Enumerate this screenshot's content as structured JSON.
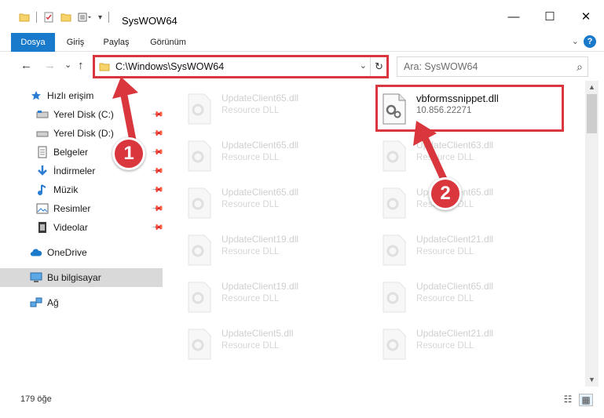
{
  "window": {
    "title": "SysWOW64",
    "minimize": "—",
    "maximize": "☐",
    "close": "✕"
  },
  "ribbon": {
    "tabs": [
      "Dosya",
      "Giriş",
      "Paylaş",
      "Görünüm"
    ],
    "help": "?"
  },
  "navigation": {
    "back": "←",
    "forward": "→",
    "recent": "⌄",
    "up": "↑",
    "address": "C:\\Windows\\SysWOW64",
    "refresh": "↻",
    "search_placeholder": "Ara: SysWOW64"
  },
  "sidebar": {
    "items": [
      {
        "label": "Hızlı erişim",
        "icon": "star-icon",
        "pinned": false
      },
      {
        "label": "Yerel Disk (C:)",
        "icon": "drive-icon",
        "pinned": true
      },
      {
        "label": "Yerel Disk (D:)",
        "icon": "drive-icon",
        "pinned": true
      },
      {
        "label": "Belgeler",
        "icon": "documents-icon",
        "pinned": true
      },
      {
        "label": "İndirmeler",
        "icon": "download-icon",
        "pinned": true
      },
      {
        "label": "Müzik",
        "icon": "music-icon",
        "pinned": true
      },
      {
        "label": "Resimler",
        "icon": "pictures-icon",
        "pinned": true
      },
      {
        "label": "Videolar",
        "icon": "videos-icon",
        "pinned": true
      },
      {
        "label": "OneDrive",
        "icon": "cloud-icon",
        "pinned": false
      },
      {
        "label": "Bu bilgisayar",
        "icon": "computer-icon",
        "pinned": false,
        "selected": true
      },
      {
        "label": "Ağ",
        "icon": "network-icon",
        "pinned": false
      }
    ]
  },
  "files": {
    "highlighted": {
      "name": "vbformssnippet.dll",
      "subtitle": "10.856.22271"
    },
    "left_column": [
      {
        "name": "UpdateClient65.dll",
        "subtitle": "Resource DLL"
      },
      {
        "name": "UpdateClient65.dll",
        "subtitle": "Resource DLL"
      },
      {
        "name": "UpdateClient65.dll",
        "subtitle": "Resource DLL"
      },
      {
        "name": "UpdateClient19.dll",
        "subtitle": "Resource DLL"
      },
      {
        "name": "UpdateClient19.dll",
        "subtitle": "Resource DLL"
      },
      {
        "name": "UpdateClient5.dll",
        "subtitle": "Resource DLL"
      }
    ],
    "right_column": [
      {
        "name": "UpdateClient63.dll",
        "subtitle": "Resource DLL"
      },
      {
        "name": "UpdateClient65.dll",
        "subtitle": "Resource DLL"
      },
      {
        "name": "UpdateClient21.dll",
        "subtitle": "Resource DLL"
      },
      {
        "name": "UpdateClient65.dll",
        "subtitle": "Resource DLL"
      },
      {
        "name": "UpdateClient21.dll",
        "subtitle": "Resource DLL"
      }
    ]
  },
  "status": {
    "item_count": "179 öğe"
  },
  "callouts": {
    "one": "1",
    "two": "2"
  },
  "colors": {
    "accent": "#1979ca",
    "highlight_red": "#d9363e"
  }
}
